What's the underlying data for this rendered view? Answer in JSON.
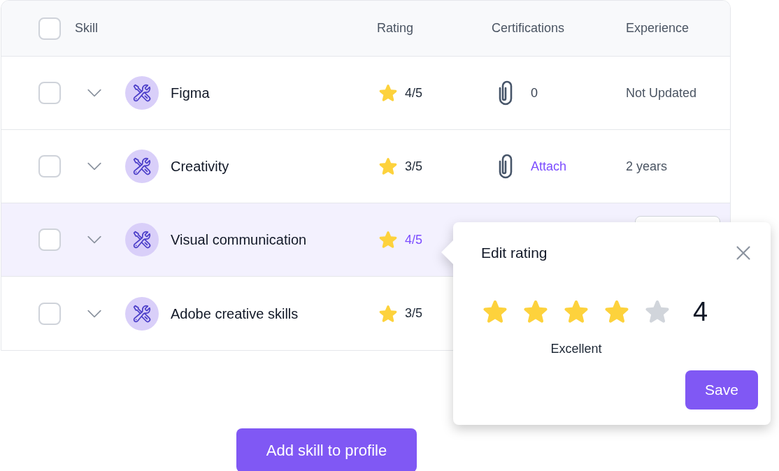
{
  "table": {
    "select_all": {
      "checked": false
    },
    "columns": [
      "Skill",
      "Rating",
      "Certifications",
      "Experience"
    ],
    "rows": [
      {
        "name": "Figma",
        "checked": false,
        "selected": false,
        "rating": "4/5",
        "certification": {
          "kind": "count",
          "text": "0"
        },
        "experience": {
          "kind": "text",
          "text": "Not Updated"
        }
      },
      {
        "name": "Creativity",
        "checked": false,
        "selected": false,
        "rating": "3/5",
        "certification": {
          "kind": "link",
          "text": "Attach"
        },
        "experience": {
          "kind": "text",
          "text": "2 years"
        }
      },
      {
        "name": "Visual communication",
        "checked": false,
        "selected": true,
        "rating": "4/5",
        "experience": {
          "kind": "button"
        }
      },
      {
        "name": "Adobe creative skills",
        "checked": false,
        "selected": false,
        "rating": "3/5"
      }
    ]
  },
  "rating_popover": {
    "title": "Edit rating",
    "stars": 4,
    "value": "4",
    "label": "Excellent",
    "button": "Save"
  },
  "add_button": "Add skill to profile"
}
